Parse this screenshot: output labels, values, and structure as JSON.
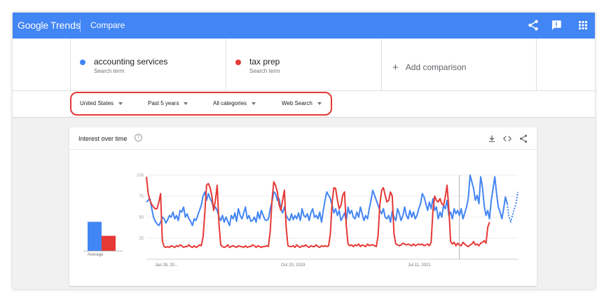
{
  "header": {
    "brand_google": "Google",
    "brand_trends": "Trends",
    "page": "Compare"
  },
  "terms": [
    {
      "name": "accounting services",
      "type": "Search term",
      "color": "#4285f4"
    },
    {
      "name": "tax prep",
      "type": "Search term",
      "color": "#e53935"
    }
  ],
  "add_comparison": "Add comparison",
  "filters": {
    "region": "United States",
    "time": "Past 5 years",
    "category": "All categories",
    "search_type": "Web Search"
  },
  "card": {
    "title": "Interest over time",
    "help": "?"
  },
  "icons": {
    "share": "share-icon",
    "feedback": "feedback-icon",
    "apps": "apps-grid-icon",
    "download": "download-icon",
    "embed": "embed-code-icon",
    "card_share": "share-icon"
  },
  "average_label": "Average",
  "chart_data": {
    "type": "line",
    "ylim": [
      0,
      100
    ],
    "ytick_labels": [
      "100",
      "75",
      "50",
      "25"
    ],
    "xtick_labels": [
      "Jan 28, 20...",
      "Oct 20, 2019",
      "Jul 11, 2021"
    ],
    "averages": [
      {
        "name": "accounting services",
        "value": 55
      },
      {
        "name": "tax prep",
        "value": 29
      }
    ],
    "series": [
      {
        "name": "accounting services",
        "color": "#4285f4",
        "values": [
          68,
          70,
          72,
          60,
          50,
          45,
          42,
          40,
          44,
          50,
          48,
          43,
          47,
          52,
          50,
          56,
          48,
          52,
          46,
          58,
          56,
          62,
          50,
          54,
          48,
          45,
          40,
          48,
          46,
          52,
          58,
          64,
          75,
          80,
          70,
          78,
          72,
          68,
          60,
          62,
          58,
          50,
          46,
          52,
          44,
          50,
          45,
          40,
          52,
          48,
          55,
          45,
          60,
          52,
          48,
          55,
          62,
          48,
          52,
          45,
          46,
          50,
          44,
          56,
          48,
          58,
          52,
          47,
          46,
          48,
          60,
          68,
          80,
          78,
          70,
          72,
          60,
          55,
          62,
          52,
          48,
          46,
          54,
          47,
          52,
          48,
          55,
          46,
          60,
          52,
          50,
          54,
          46,
          55,
          60,
          50,
          52,
          48,
          56,
          44,
          58,
          70,
          80,
          76,
          72,
          64,
          55,
          60,
          52,
          58,
          46,
          50,
          55,
          46,
          62,
          54,
          58,
          50,
          48,
          56,
          50,
          62,
          54,
          46,
          52,
          48,
          60,
          70,
          82,
          76,
          70,
          64,
          58,
          54,
          60,
          50,
          48,
          52,
          44,
          57,
          50,
          46,
          60,
          54,
          46,
          52,
          62,
          52,
          48,
          58,
          50,
          56,
          48,
          52,
          60,
          66,
          78,
          74,
          66,
          58,
          68,
          60,
          72,
          58,
          62,
          48,
          56,
          50,
          64,
          60,
          70,
          52,
          56,
          48,
          60,
          54,
          58,
          52,
          60,
          48,
          55,
          62,
          72,
          100,
          92,
          84,
          70,
          76,
          66,
          98,
          86,
          64,
          52,
          58,
          48,
          70,
          84,
          98,
          78,
          62,
          56,
          48,
          60,
          74,
          66,
          50,
          45,
          52,
          60,
          66,
          80
        ]
      },
      {
        "name": "tax prep",
        "color": "#e53935",
        "values": [
          98,
          78,
          70,
          65,
          62,
          60,
          60,
          68,
          78,
          22,
          15,
          14,
          15,
          14,
          16,
          15,
          14,
          16,
          15,
          17,
          16,
          14,
          15,
          15,
          17,
          15,
          14,
          16,
          14,
          15,
          17,
          16,
          26,
          55,
          88,
          90,
          85,
          75,
          58,
          70,
          88,
          42,
          17,
          15,
          14,
          15,
          17,
          14,
          15,
          16,
          15,
          14,
          16,
          15,
          15,
          14,
          16,
          14,
          15,
          15,
          17,
          16,
          14,
          16,
          15,
          14,
          15,
          15,
          16,
          15,
          34,
          70,
          92,
          88,
          80,
          65,
          58,
          70,
          82,
          38,
          16,
          15,
          15,
          16,
          14,
          17,
          15,
          14,
          16,
          15,
          17,
          15,
          14,
          16,
          15,
          15,
          17,
          15,
          14,
          16,
          15,
          16,
          15,
          16,
          30,
          68,
          85,
          84,
          70,
          60,
          64,
          76,
          80,
          40,
          18,
          16,
          17,
          15,
          17,
          16,
          18,
          15,
          17,
          16,
          15,
          18,
          16,
          17,
          17,
          16,
          15,
          28,
          65,
          82,
          85,
          76,
          68,
          70,
          80,
          75,
          30,
          18,
          17,
          16,
          17,
          19,
          18,
          17,
          18,
          17,
          16,
          18,
          16,
          17,
          18,
          17,
          18,
          16,
          17,
          18,
          16,
          20,
          58,
          75,
          70,
          68,
          72,
          66,
          64,
          74,
          88,
          60,
          21,
          18,
          20,
          16,
          19,
          17,
          16,
          20,
          18,
          16,
          15,
          17,
          18,
          21,
          17,
          18,
          16,
          19,
          20,
          22,
          19,
          38,
          44
        ]
      }
    ]
  }
}
